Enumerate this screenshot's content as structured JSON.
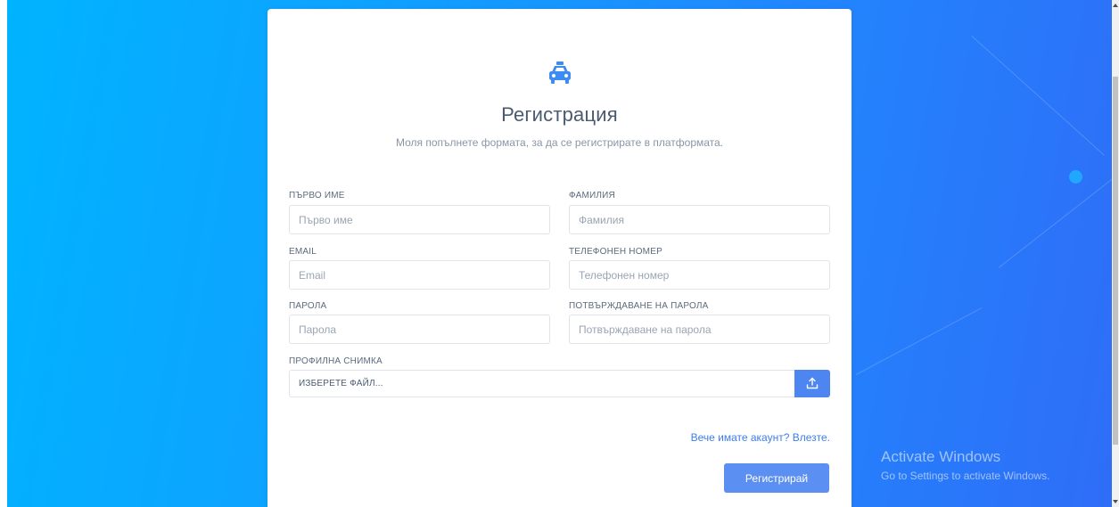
{
  "form": {
    "title": "Регистрация",
    "subtitle": "Моля попълнете формата, за да се регистрирате в платформата.",
    "fields": {
      "first_name": {
        "label": "Първо име",
        "placeholder": "Първо име"
      },
      "last_name": {
        "label": "Фамилия",
        "placeholder": "Фамилия"
      },
      "email": {
        "label": "Email",
        "placeholder": "Email"
      },
      "phone": {
        "label": "Телефонен номер",
        "placeholder": "Телефонен номер"
      },
      "password": {
        "label": "Парола",
        "placeholder": "Парола"
      },
      "password_confirm": {
        "label": "Потвърждаване на парола",
        "placeholder": "Потвърждаване на парола"
      }
    },
    "profile_picture": {
      "label": "Профилна снимка",
      "file_placeholder": "ИЗБЕРЕТЕ ФАЙЛ..."
    },
    "login_link": "Вече имате акаунт? Влезте.",
    "submit_label": "Регистрирай"
  },
  "icons": {
    "logo": "taxi-icon",
    "upload": "upload-icon"
  },
  "watermark": {
    "title": "Activate Windows",
    "subtitle": "Go to Settings to activate Windows."
  },
  "colors": {
    "accent": "#4d86f0",
    "link": "#3c7ef0",
    "title_text": "#4a5a70",
    "background_start": "#00b4ff",
    "background_end": "#2f6df7"
  }
}
